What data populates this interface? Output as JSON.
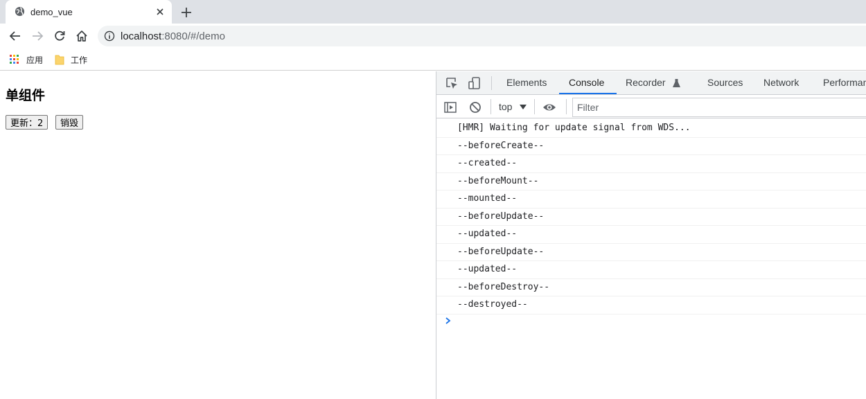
{
  "browser": {
    "tab_title": "demo_vue",
    "url_host": "localhost",
    "url_rest": ":8080/#/demo",
    "bookmarks": [
      {
        "label": "应用",
        "icon": "apps-grid-icon"
      },
      {
        "label": "工作",
        "icon": "folder-icon"
      }
    ]
  },
  "page": {
    "heading": "单组件",
    "update_button": "更新：2",
    "destroy_button": "销毁"
  },
  "devtools": {
    "tabs": [
      "Elements",
      "Console",
      "Recorder",
      "Sources",
      "Network",
      "Performan"
    ],
    "active_tab": "Console",
    "context": "top",
    "filter_placeholder": "Filter",
    "logs": [
      "[HMR] Waiting for update signal from WDS...",
      "--beforeCreate--",
      "--created--",
      "--beforeMount--",
      "--mounted--",
      "--beforeUpdate--",
      "--updated--",
      "--beforeUpdate--",
      "--updated--",
      "--beforeDestroy--",
      "--destroyed--"
    ]
  },
  "colors": {
    "accent": "#1a73e8",
    "tabstrip": "#dee1e6"
  }
}
